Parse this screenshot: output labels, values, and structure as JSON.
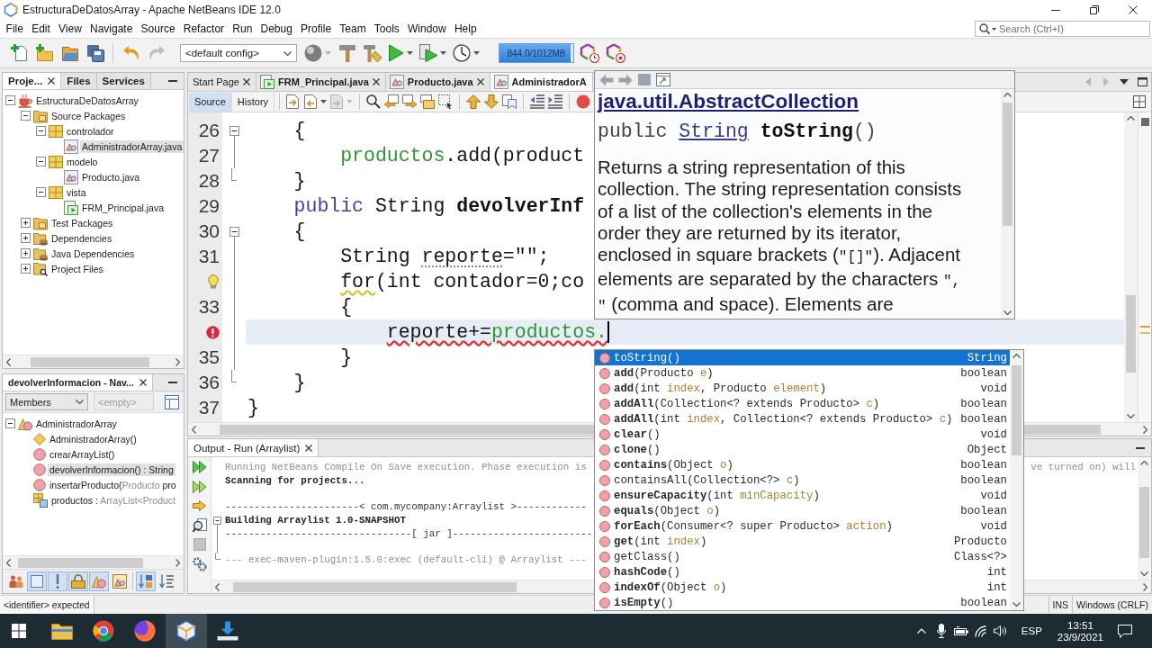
{
  "window": {
    "title": "EstructuraDeDatosArray - Apache NetBeans IDE 12.0"
  },
  "menu": [
    "File",
    "Edit",
    "View",
    "Navigate",
    "Source",
    "Refactor",
    "Run",
    "Debug",
    "Profile",
    "Team",
    "Tools",
    "Window",
    "Help"
  ],
  "search": {
    "placeholder": "Search (Ctrl+I)"
  },
  "toolbar": {
    "undo": {
      "disabled": false
    },
    "redo": {
      "disabled": true
    },
    "config": "<default config>",
    "memory": {
      "reading": "844.0/1012MB",
      "level": 0.96
    }
  },
  "projects": {
    "tabs": [
      {
        "label": "Proje...",
        "selected": true
      },
      {
        "label": "Files",
        "selected": false
      },
      {
        "label": "Services",
        "selected": false
      }
    ],
    "tree": [
      {
        "label": "EstructuraDeDatosArray",
        "kind": "project",
        "expanded": true,
        "selected": false,
        "children": [
          {
            "label": "Source Packages",
            "kind": "source-root",
            "expanded": true,
            "selected": false,
            "children": [
              {
                "label": "controlador",
                "kind": "package",
                "expanded": true,
                "selected": false,
                "children": [
                  {
                    "label": "AdministradorArray.java",
                    "kind": "class",
                    "selected": true
                  }
                ]
              },
              {
                "label": "modelo",
                "kind": "package",
                "expanded": true,
                "selected": false,
                "children": [
                  {
                    "label": "Producto.java",
                    "kind": "class",
                    "selected": false
                  }
                ]
              },
              {
                "label": "vista",
                "kind": "package",
                "expanded": true,
                "selected": false,
                "children": [
                  {
                    "label": "FRM_Principal.java",
                    "kind": "form",
                    "selected": false
                  }
                ]
              }
            ]
          },
          {
            "label": "Test Packages",
            "kind": "test-root",
            "expanded": false,
            "selected": false
          },
          {
            "label": "Dependencies",
            "kind": "dependencies",
            "expanded": false,
            "selected": false
          },
          {
            "label": "Java Dependencies",
            "kind": "dependencies",
            "expanded": false,
            "selected": false
          },
          {
            "label": "Project Files",
            "kind": "project-files",
            "expanded": false,
            "selected": false
          }
        ]
      }
    ]
  },
  "navigator": {
    "title": "devolverInformacion - Nav...",
    "view": "Members",
    "filter": {
      "value": "<empty>",
      "disabled": true
    },
    "tree": [
      {
        "label": [
          {
            "text": "AdministradorArray",
            "kind": "plain"
          }
        ],
        "kind": "class",
        "expanded": true,
        "selected": false,
        "children": [
          {
            "label": [
              {
                "text": "AdministradorArray()",
                "kind": "plain"
              }
            ],
            "kind": "constructor",
            "selected": false
          },
          {
            "label": [
              {
                "text": "crearArrayList()",
                "kind": "plain"
              }
            ],
            "kind": "method",
            "selected": false
          },
          {
            "label": [
              {
                "text": "devolverInformacion() : String",
                "kind": "plain"
              }
            ],
            "kind": "method",
            "selected": true
          },
          {
            "label": [
              {
                "text": "insertarProducto(",
                "kind": "plain"
              },
              {
                "text": "Producto",
                "kind": "muted"
              },
              {
                "text": " pro",
                "kind": "plain"
              }
            ],
            "kind": "method",
            "selected": false
          },
          {
            "label": [
              {
                "text": "productos : ",
                "kind": "plain"
              },
              {
                "text": "ArrayList<Product",
                "kind": "muted"
              }
            ],
            "kind": "field",
            "selected": false
          }
        ]
      }
    ],
    "filters": [
      {
        "on": false
      },
      {
        "on": true
      },
      {
        "on": true
      },
      {
        "on": true
      },
      {
        "on": true
      },
      {
        "on": false
      },
      {
        "on": true
      },
      {
        "on": false
      }
    ]
  },
  "editor": {
    "tabs": [
      {
        "label": "Start Page",
        "kind": "page",
        "selected": false,
        "modified": false,
        "close_button": true
      },
      {
        "label": "FRM_Principal.java",
        "kind": "form",
        "selected": false,
        "modified": true,
        "close_button": true
      },
      {
        "label": "Producto.java",
        "kind": "class",
        "selected": false,
        "modified": true,
        "close_button": true
      },
      {
        "label": "AdministradorA",
        "kind": "class",
        "selected": true,
        "modified": true,
        "close_button": false
      }
    ],
    "views": [
      {
        "label": "Source",
        "selected": true
      },
      {
        "label": "History",
        "selected": false
      }
    ],
    "nav": {
      "back": {
        "disabled": false
      },
      "forward": {
        "disabled": true
      }
    },
    "lines": [
      {
        "kind": "numbered",
        "number": "26",
        "fold_start": true,
        "fold_end": false,
        "current": false,
        "tokens": [
          {
            "text": "    {",
            "kind": "plain"
          }
        ]
      },
      {
        "kind": "numbered",
        "number": "27",
        "fold_start": false,
        "fold_end": false,
        "current": false,
        "tokens": [
          {
            "text": "        productos",
            "kind": "field"
          },
          {
            "text": ".add(product",
            "kind": "plain"
          }
        ]
      },
      {
        "kind": "numbered",
        "number": "28",
        "fold_start": false,
        "fold_end": true,
        "current": false,
        "tokens": [
          {
            "text": "    }",
            "kind": "plain"
          }
        ]
      },
      {
        "kind": "numbered",
        "number": "29",
        "fold_start": false,
        "fold_end": false,
        "current": false,
        "tokens": [
          {
            "text": "    public",
            "kind": "keyword"
          },
          {
            "text": " String ",
            "kind": "plain"
          },
          {
            "text": "devolverInf",
            "kind": "declaration"
          }
        ]
      },
      {
        "kind": "numbered",
        "number": "30",
        "fold_start": true,
        "fold_end": false,
        "current": false,
        "tokens": [
          {
            "text": "    {",
            "kind": "plain"
          }
        ]
      },
      {
        "kind": "numbered",
        "number": "31",
        "fold_start": false,
        "fold_end": false,
        "current": false,
        "tokens": [
          {
            "text": "        String ",
            "kind": "plain"
          },
          {
            "text": "reporte",
            "kind": "unused"
          },
          {
            "text": "=\"\";",
            "kind": "plain"
          }
        ]
      },
      {
        "kind": "hint",
        "fold_start": false,
        "fold_end": false,
        "current": false,
        "tokens": [
          {
            "text": "        for",
            "kind": "hint"
          },
          {
            "text": "(int contador=0;co",
            "kind": "plain"
          }
        ]
      },
      {
        "kind": "numbered",
        "number": "33",
        "fold_start": false,
        "fold_end": false,
        "current": false,
        "tokens": [
          {
            "text": "        {",
            "kind": "plain"
          }
        ]
      },
      {
        "kind": "error",
        "fold_start": false,
        "fold_end": false,
        "current": true,
        "tokens": [
          {
            "text": "            reporte+=",
            "kind": "error"
          },
          {
            "text": "productos.",
            "kind": "error-field"
          }
        ]
      },
      {
        "kind": "numbered",
        "number": "35",
        "fold_start": false,
        "fold_end": false,
        "current": false,
        "tokens": [
          {
            "text": "        }",
            "kind": "plain"
          }
        ]
      },
      {
        "kind": "numbered",
        "number": "36",
        "fold_start": false,
        "fold_end": true,
        "current": false,
        "tokens": [
          {
            "text": "    }",
            "kind": "plain"
          }
        ]
      },
      {
        "kind": "numbered",
        "number": "37",
        "fold_start": false,
        "fold_end": false,
        "current": false,
        "tokens": [
          {
            "text": "}",
            "kind": "plain"
          }
        ]
      }
    ]
  },
  "javadoc": {
    "heading": "java.util.AbstractCollection",
    "signature": [
      {
        "text": "public ",
        "kind": "plain"
      },
      {
        "text": "String",
        "kind": "link"
      },
      {
        "text": " toString",
        "kind": "bold"
      },
      {
        "text": "()",
        "kind": "plain"
      }
    ],
    "description": [
      [
        {
          "text": "Returns a string representation of this",
          "kind": "plain"
        }
      ],
      [
        {
          "text": "collection. The string representation consists",
          "kind": "plain"
        }
      ],
      [
        {
          "text": "of a list of the collection's elements in the",
          "kind": "plain"
        }
      ],
      [
        {
          "text": "order they are returned by its iterator,",
          "kind": "plain"
        }
      ],
      [
        {
          "text": "enclosed in square brackets (",
          "kind": "plain"
        },
        {
          "text": "\"[]\"",
          "kind": "code"
        },
        {
          "text": "). Adjacent",
          "kind": "plain"
        }
      ],
      [
        {
          "text": "elements are separated by the characters ",
          "kind": "plain"
        },
        {
          "text": "\",",
          "kind": "code"
        }
      ],
      [
        {
          "text": "\"",
          "kind": "code"
        },
        {
          "text": " (comma and space). Elements are",
          "kind": "plain"
        }
      ]
    ]
  },
  "completion": {
    "items": [
      {
        "selected": true,
        "type": "String",
        "signature": [
          {
            "text": "toString",
            "kind": "inherited"
          },
          {
            "text": "()",
            "kind": "plain"
          }
        ]
      },
      {
        "selected": false,
        "type": "boolean",
        "signature": [
          {
            "text": "add",
            "kind": "method"
          },
          {
            "text": "(Producto ",
            "kind": "plain"
          },
          {
            "text": "e",
            "kind": "param"
          },
          {
            "text": ")",
            "kind": "plain"
          }
        ]
      },
      {
        "selected": false,
        "type": "void",
        "signature": [
          {
            "text": "add",
            "kind": "method"
          },
          {
            "text": "(int ",
            "kind": "plain"
          },
          {
            "text": "index",
            "kind": "param"
          },
          {
            "text": ", Producto ",
            "kind": "plain"
          },
          {
            "text": "element",
            "kind": "param"
          },
          {
            "text": ")",
            "kind": "plain"
          }
        ]
      },
      {
        "selected": false,
        "type": "boolean",
        "signature": [
          {
            "text": "addAll",
            "kind": "method"
          },
          {
            "text": "(Collection<? extends Producto> ",
            "kind": "plain"
          },
          {
            "text": "c",
            "kind": "param"
          },
          {
            "text": ")",
            "kind": "plain"
          }
        ]
      },
      {
        "selected": false,
        "type": "boolean",
        "signature": [
          {
            "text": "addAll",
            "kind": "method"
          },
          {
            "text": "(int ",
            "kind": "plain"
          },
          {
            "text": "index",
            "kind": "param"
          },
          {
            "text": ", Collection<? extends Producto> ",
            "kind": "plain"
          },
          {
            "text": "c",
            "kind": "param"
          },
          {
            "text": ")",
            "kind": "plain"
          }
        ]
      },
      {
        "selected": false,
        "type": "void",
        "signature": [
          {
            "text": "clear",
            "kind": "method"
          },
          {
            "text": "()",
            "kind": "plain"
          }
        ]
      },
      {
        "selected": false,
        "type": "Object",
        "signature": [
          {
            "text": "clone",
            "kind": "method"
          },
          {
            "text": "()",
            "kind": "plain"
          }
        ]
      },
      {
        "selected": false,
        "type": "boolean",
        "signature": [
          {
            "text": "contains",
            "kind": "method"
          },
          {
            "text": "(Object ",
            "kind": "plain"
          },
          {
            "text": "o",
            "kind": "param"
          },
          {
            "text": ")",
            "kind": "plain"
          }
        ]
      },
      {
        "selected": false,
        "type": "boolean",
        "signature": [
          {
            "text": "containsAll",
            "kind": "inherited"
          },
          {
            "text": "(Collection<?> ",
            "kind": "plain"
          },
          {
            "text": "c",
            "kind": "param"
          },
          {
            "text": ")",
            "kind": "plain"
          }
        ]
      },
      {
        "selected": false,
        "type": "void",
        "signature": [
          {
            "text": "ensureCapacity",
            "kind": "method"
          },
          {
            "text": "(int ",
            "kind": "plain"
          },
          {
            "text": "minCapacity",
            "kind": "param"
          },
          {
            "text": ")",
            "kind": "plain"
          }
        ]
      },
      {
        "selected": false,
        "type": "boolean",
        "signature": [
          {
            "text": "equals",
            "kind": "method"
          },
          {
            "text": "(Object ",
            "kind": "plain"
          },
          {
            "text": "o",
            "kind": "param"
          },
          {
            "text": ")",
            "kind": "plain"
          }
        ]
      },
      {
        "selected": false,
        "type": "void",
        "signature": [
          {
            "text": "forEach",
            "kind": "method"
          },
          {
            "text": "(Consumer<? super Producto> ",
            "kind": "plain"
          },
          {
            "text": "action",
            "kind": "param"
          },
          {
            "text": ")",
            "kind": "plain"
          }
        ]
      },
      {
        "selected": false,
        "type": "Producto",
        "signature": [
          {
            "text": "get",
            "kind": "method"
          },
          {
            "text": "(int ",
            "kind": "plain"
          },
          {
            "text": "index",
            "kind": "param"
          },
          {
            "text": ")",
            "kind": "plain"
          }
        ]
      },
      {
        "selected": false,
        "type": "Class<?>",
        "signature": [
          {
            "text": "getClass",
            "kind": "inherited"
          },
          {
            "text": "()",
            "kind": "plain"
          }
        ]
      },
      {
        "selected": false,
        "type": "int",
        "signature": [
          {
            "text": "hashCode",
            "kind": "method"
          },
          {
            "text": "()",
            "kind": "plain"
          }
        ]
      },
      {
        "selected": false,
        "type": "int",
        "signature": [
          {
            "text": "indexOf",
            "kind": "method"
          },
          {
            "text": "(Object ",
            "kind": "plain"
          },
          {
            "text": "o",
            "kind": "param"
          },
          {
            "text": ")",
            "kind": "plain"
          }
        ]
      },
      {
        "selected": false,
        "type": "boolean",
        "signature": [
          {
            "text": "isEmpty",
            "kind": "method"
          },
          {
            "text": "()",
            "kind": "plain"
          }
        ]
      }
    ]
  },
  "output": {
    "tab": {
      "label": "Output - Run (Arraylist)",
      "selected": true
    },
    "stop": {
      "disabled": true
    },
    "lines": [
      {
        "kind": "muted",
        "text": "Running NetBeans Compile On Save execution. Phase execution is",
        "tail": "ve turned on) will",
        "fold_start": false,
        "fold_end": false
      },
      {
        "kind": "strong",
        "text": "Scanning for projects...",
        "fold_start": false,
        "fold_end": false
      },
      {
        "kind": "blank",
        "fold_start": false,
        "fold_end": false
      },
      {
        "kind": "plain",
        "text": "-----------------------< com.mycompany:Arraylist >------------",
        "fold_start": false,
        "fold_end": false
      },
      {
        "kind": "strong",
        "text": "Building Arraylist 1.0-SNAPSHOT",
        "fold_start": true,
        "fold_end": false
      },
      {
        "kind": "plain",
        "text": "--------------------------------[ jar ]------------------------",
        "fold_start": false,
        "fold_end": false
      },
      {
        "kind": "blank",
        "fold_start": false,
        "fold_end": false
      },
      {
        "kind": "muted",
        "text": "--- exec-maven-plugin:1.5.0:exec (default-cli) @ Arraylist ---",
        "fold_start": false,
        "fold_end": true
      }
    ]
  },
  "status": {
    "message": "<identifier> expected",
    "mode": "INS",
    "line_endings": "Windows (CRLF)"
  },
  "taskbar": {
    "apps": [
      {
        "selected": false
      },
      {
        "selected": false
      },
      {
        "selected": false
      },
      {
        "selected": true
      },
      {
        "selected": false
      }
    ],
    "language": "ESP",
    "time": "13:51",
    "date": "23/9/2021"
  }
}
